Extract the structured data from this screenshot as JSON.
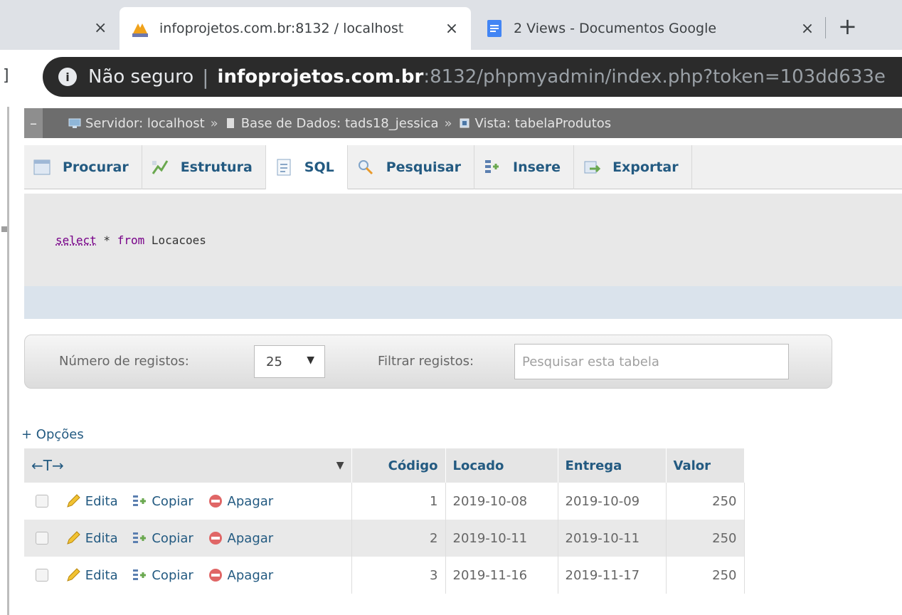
{
  "browser": {
    "prev_tab_close": "×",
    "tabs": [
      {
        "title": "infoprojetos.com.br:8132 / localhost",
        "close": "×"
      },
      {
        "title": "2 Views - Documentos Google",
        "close": "×"
      }
    ],
    "new_tab": "+",
    "security_label": "Não seguro",
    "url_host": "infoprojetos.com.br",
    "url_rest": ":8132/phpmyadmin/index.php?token=103dd633e",
    "colors": {
      "tab_bar": "#dee1e6",
      "omnibox": "#2b2b2b"
    }
  },
  "breadcrumb": {
    "collapse": "–",
    "server": "Servidor: localhost",
    "database": "Base de Dados: tads18_jessica",
    "view": "Vista: tabelaProdutos",
    "separator": "»"
  },
  "menu": [
    {
      "label": "Procurar",
      "icon": "browse-icon"
    },
    {
      "label": "Estrutura",
      "icon": "structure-icon"
    },
    {
      "label": "SQL",
      "icon": "sql-icon",
      "active": true
    },
    {
      "label": "Pesquisar",
      "icon": "search-icon"
    },
    {
      "label": "Insere",
      "icon": "insert-icon"
    },
    {
      "label": "Exportar",
      "icon": "export-icon"
    }
  ],
  "query": {
    "select": "select",
    "star": " * ",
    "from": "from",
    "table": " Locacoes"
  },
  "filters": {
    "rows_label": "Número de registos:",
    "rows_value": "25",
    "filter_label": "Filtrar registos:",
    "filter_placeholder": "Pesquisar esta tabela"
  },
  "options_label": "+ Opções",
  "table": {
    "arrows": "←T→",
    "headers": [
      "Código",
      "Locado",
      "Entrega",
      "Valor"
    ],
    "actions": {
      "edit": "Edita",
      "copy": "Copiar",
      "delete": "Apagar"
    },
    "rows": [
      [
        "1",
        "2019-10-08",
        "2019-10-09",
        "250"
      ],
      [
        "2",
        "2019-10-11",
        "2019-10-11",
        "250"
      ],
      [
        "3",
        "2019-11-16",
        "2019-11-17",
        "250"
      ]
    ]
  },
  "colors": {
    "link": "#235a81",
    "sql_keyword": "#770088",
    "breadcrumb_bg": "#6d6d6d"
  }
}
